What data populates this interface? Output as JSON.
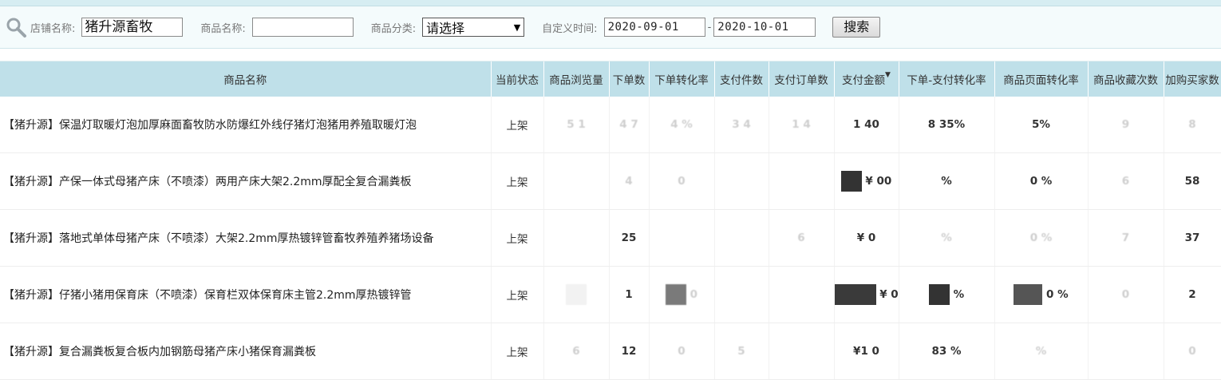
{
  "filter": {
    "shop_label": "店铺名称:",
    "shop_value": "猪升源畜牧",
    "product_label": "商品名称:",
    "product_value": "",
    "category_label": "商品分类:",
    "category_value": "请选择",
    "time_label": "自定义时间:",
    "date_from": "2020-09-01",
    "date_sep": "-",
    "date_to": "2020-10-01",
    "search_label": "搜索"
  },
  "table": {
    "headers": [
      "商品名称",
      "当前状态",
      "商品浏览量",
      "下单数",
      "下单转化率",
      "支付件数",
      "支付订单数",
      "支付金额",
      "下单-支付转化率",
      "商品页面转化率",
      "商品收藏次数",
      "加购买家数"
    ],
    "sort_glyph": "▼",
    "rows": [
      {
        "name": "【猪升源】保温灯取暖灯泡加厚麻面畜牧防水防爆红外线仔猪灯泡猪用养殖取暖灯泡",
        "status": "上架",
        "views": "5 1",
        "orders": "4 7",
        "order_rate": "4 %",
        "pay_items": "3 4",
        "pay_orders": "1 4",
        "pay_amount": "1 40",
        "pay_rate": "8 35%",
        "page_rate": "5%",
        "favorites": "9",
        "cart": "8"
      },
      {
        "name": "【猪升源】产保一体式母猪产床（不喷漆）两用产床大架2.2mm厚配全复合漏粪板",
        "status": "上架",
        "views": "",
        "orders": "4",
        "order_rate": "0",
        "pay_items": "",
        "pay_orders": "",
        "pay_amount": "¥ 00",
        "pay_rate": "%",
        "page_rate": "0 %",
        "favorites": "6",
        "cart": "58"
      },
      {
        "name": "【猪升源】落地式单体母猪产床（不喷漆）大架2.2mm厚热镀锌管畜牧养殖养猪场设备",
        "status": "上架",
        "views": "",
        "orders": "25",
        "order_rate": "",
        "pay_items": "",
        "pay_orders": "6",
        "pay_amount": "¥ 0",
        "pay_rate": "%",
        "page_rate": "0 %",
        "favorites": "7",
        "cart": "37"
      },
      {
        "name": "【猪升源】仔猪小猪用保育床（不喷漆）保育栏双体保育床主管2.2mm厚热镀锌管",
        "status": "上架",
        "views": "",
        "orders": "1",
        "order_rate": "0",
        "pay_items": "",
        "pay_orders": "",
        "pay_amount": "¥ 0",
        "pay_rate": "%",
        "page_rate": "0 %",
        "favorites": "0",
        "cart": "2"
      },
      {
        "name": "【猪升源】复合漏粪板复合板内加钢筋母猪产床小猪保育漏粪板",
        "status": "上架",
        "views": "6",
        "orders": "12",
        "order_rate": "0",
        "pay_items": "5",
        "pay_orders": "",
        "pay_amount": "¥1 0",
        "pay_rate": "83 %",
        "page_rate": "%",
        "favorites": "",
        "cart": "0"
      }
    ]
  }
}
